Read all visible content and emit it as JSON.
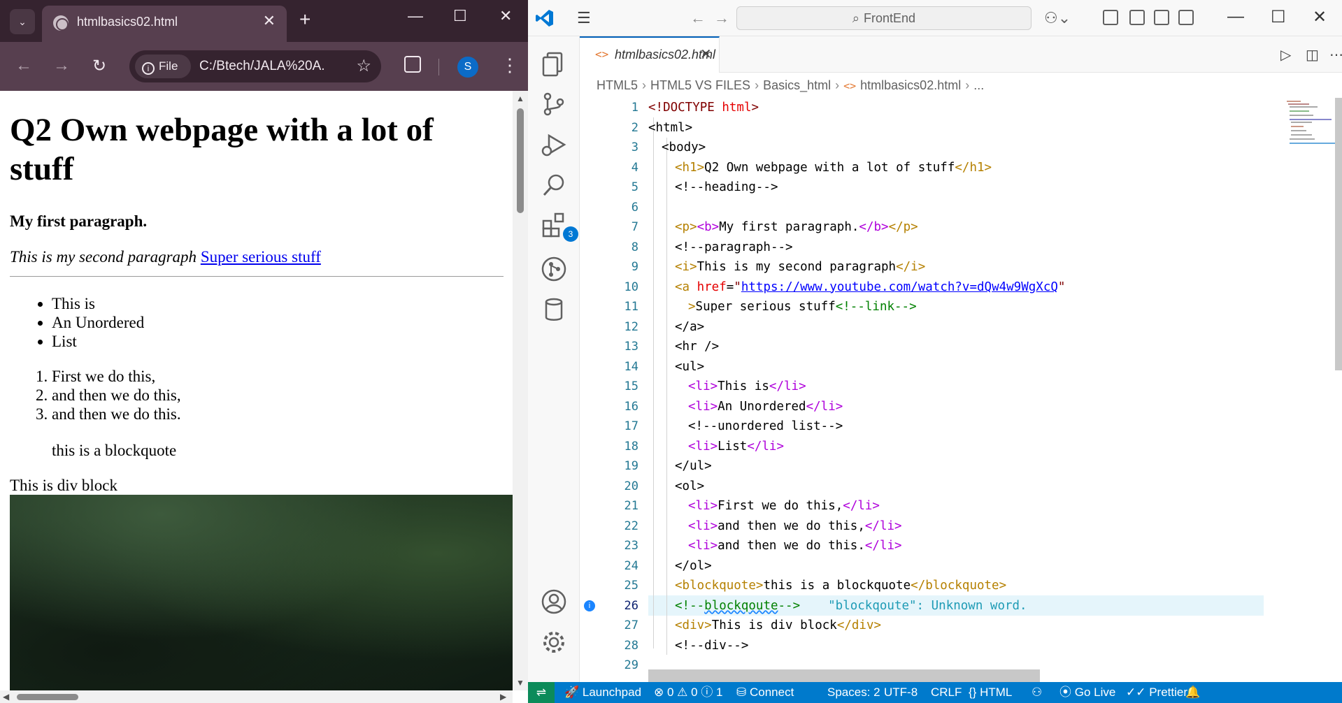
{
  "chrome": {
    "tab_title": "htmlbasics02.html",
    "url_scheme_chip": "File",
    "url": "C:/Btech/JALA%20A...",
    "profile_initial": "S",
    "page": {
      "heading": "Q2 Own webpage with a lot of stuff",
      "paragraph1": "My first paragraph.",
      "italic_text": "This is my second paragraph",
      "link_text": "Super serious stuff",
      "ul_items": [
        "This is",
        "An Unordered",
        "List"
      ],
      "ol_items": [
        "First we do this,",
        "and then we do this,",
        "and then we do this."
      ],
      "blockquote": "this is a blockquote",
      "div_text": "This is div block"
    }
  },
  "vscode": {
    "search_placeholder": "FrontEnd",
    "tab_name": "htmlbasics02.html",
    "breadcrumbs": [
      "HTML5",
      "HTML5 VS FILES",
      "Basics_html",
      "htmlbasics02.html",
      "..."
    ],
    "extensions_badge": "3",
    "line_numbers": [
      "1",
      "2",
      "3",
      "4",
      "5",
      "6",
      "7",
      "8",
      "9",
      "10",
      "11",
      "12",
      "13",
      "14",
      "15",
      "16",
      "17",
      "18",
      "19",
      "20",
      "21",
      "22",
      "23",
      "24",
      "25",
      "26",
      "27",
      "28",
      "29"
    ],
    "code": {
      "l1": [
        "<!DOCTYPE ",
        "html",
        ">"
      ],
      "l2": "<html>",
      "l3": "<body>",
      "l4": [
        "<h1>",
        "Q2 Own webpage with a lot of stuff",
        "</h1>"
      ],
      "l5": "<!--heading-->",
      "l7": [
        "<p>",
        "<b>",
        "My first paragraph.",
        "</b>",
        "</p>"
      ],
      "l8": "<!--paragraph-->",
      "l9": [
        "<i>",
        "This is my second paragraph",
        "</i>"
      ],
      "l10": [
        "<a ",
        "href",
        "=",
        "\"",
        "https://www.youtube.com/watch?v=dQw4w9WgXcQ",
        "\""
      ],
      "l11": [
        ">",
        "Super serious stuff",
        "<!--link-->"
      ],
      "l12": "</a>",
      "l13": "<hr />",
      "l14": "<ul>",
      "l15": [
        "<li>",
        "This is",
        "</li>"
      ],
      "l16": [
        "<li>",
        "An Unordered",
        "</li>"
      ],
      "l17": "<!--unordered list-->",
      "l18": [
        "<li>",
        "List",
        "</li>"
      ],
      "l19": "</ul>",
      "l20": "<ol>",
      "l21": [
        "<li>",
        "First we do this,",
        "</li>"
      ],
      "l22": [
        "<li>",
        "and then we do this,",
        "</li>"
      ],
      "l23": [
        "<li>",
        "and then we do this.",
        "</li>"
      ],
      "l24": "</ol>",
      "l25": [
        "<blockquote>",
        "this is a blockquote",
        "</blockquote>"
      ],
      "l26": [
        "<!--",
        "blockqoute",
        "-->"
      ],
      "l26_hint": "\"blockqoute\": Unknown word.",
      "l27": [
        "<div>",
        "This is div block",
        "</div>"
      ],
      "l28": "<!--div-->"
    },
    "statusbar": {
      "launchpad": "Launchpad",
      "errors": "0",
      "warnings": "0",
      "infos": "1",
      "connect": "Connect",
      "spaces": "Spaces: 2",
      "encoding": "UTF-8",
      "eol": "CRLF",
      "language": "HTML",
      "go_live": "Go Live",
      "prettier": "Prettier"
    }
  }
}
